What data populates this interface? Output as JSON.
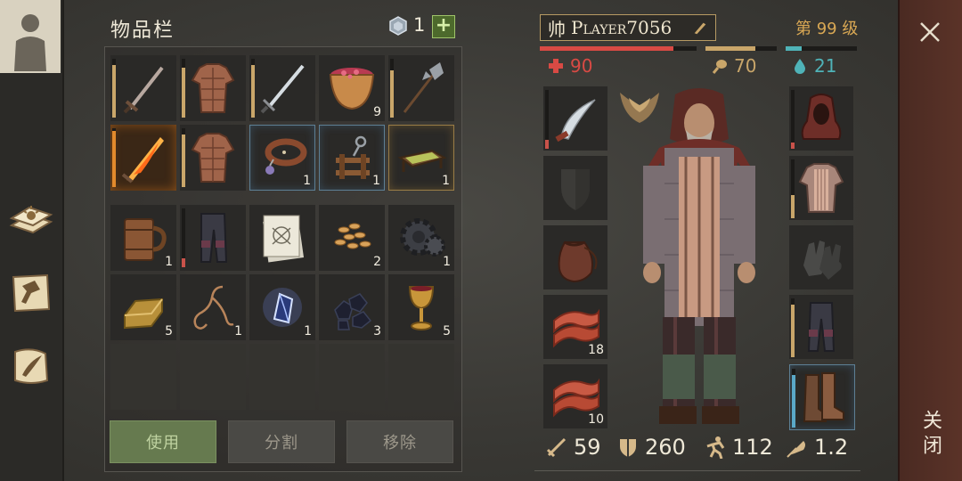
{
  "inventory": {
    "title": "物品栏",
    "gem_count": "1",
    "plus_label": "+",
    "slots": [
      {
        "icon": "sword-icon",
        "count": "",
        "durability": 0.9
      },
      {
        "icon": "padded-armor-icon",
        "count": "",
        "durability": 0.85
      },
      {
        "icon": "steel-sword-icon",
        "count": "",
        "durability": 0.9
      },
      {
        "icon": "berry-bowl-icon",
        "count": "9",
        "durability": null
      },
      {
        "icon": "halberd-icon",
        "count": "",
        "durability": 0.8
      },
      {
        "icon": "flaming-sword-icon",
        "count": "",
        "durability": 0.95
      },
      {
        "icon": "padded-armor-icon",
        "count": "",
        "durability": 0.9
      },
      {
        "icon": "leather-collar-icon",
        "count": "1",
        "durability": null
      },
      {
        "icon": "wooden-mechanism-icon",
        "count": "1",
        "durability": null
      },
      {
        "icon": "wooden-tray-icon",
        "count": "1",
        "durability": null
      },
      {
        "icon": "wooden-mug-icon",
        "count": "1",
        "durability": null
      },
      {
        "icon": "leather-pants-icon",
        "count": "",
        "durability": 0.15
      },
      {
        "icon": "scroll-map-icon",
        "count": "",
        "durability": null
      },
      {
        "icon": "grain-seeds-icon",
        "count": "2",
        "durability": null
      },
      {
        "icon": "gear-icon",
        "count": "1",
        "durability": null
      },
      {
        "icon": "gold-ingot-icon",
        "count": "5",
        "durability": null
      },
      {
        "icon": "rope-icon",
        "count": "1",
        "durability": null
      },
      {
        "icon": "crystal-icon",
        "count": "1",
        "durability": null
      },
      {
        "icon": "coal-icon",
        "count": "3",
        "durability": null
      },
      {
        "icon": "goblet-icon",
        "count": "5",
        "durability": null
      }
    ],
    "buttons": {
      "use": "使用",
      "split": "分割",
      "remove": "移除"
    }
  },
  "character": {
    "emblem": "帅",
    "name": "Player7056",
    "level": "第 99 级",
    "health": "90",
    "food": "70",
    "water": "21",
    "health_fraction": 0.85,
    "food_fraction": 0.7,
    "water_fraction": 0.22,
    "left_slots": [
      {
        "icon": "scimitar-icon",
        "count": ""
      },
      {
        "icon": "shield-icon",
        "count": ""
      },
      {
        "icon": "leather-pouch-icon",
        "count": ""
      },
      {
        "icon": "bacon-icon",
        "count": "18"
      },
      {
        "icon": "bacon-icon",
        "count": "10"
      }
    ],
    "right_slots": [
      {
        "icon": "hood-icon",
        "count": ""
      },
      {
        "icon": "chainmail-shirt-icon",
        "count": ""
      },
      {
        "icon": "gloves-icon",
        "count": ""
      },
      {
        "icon": "pants-icon",
        "count": ""
      },
      {
        "icon": "boots-icon",
        "count": ""
      }
    ],
    "stats": {
      "attack": "59",
      "armor": "260",
      "speed": "112",
      "weight": "1.2"
    }
  },
  "close_label": "关闭",
  "colors": {
    "health": "#d94a44",
    "food": "#c9a66a",
    "water": "#4fb3b8",
    "level": "#d9a854"
  }
}
